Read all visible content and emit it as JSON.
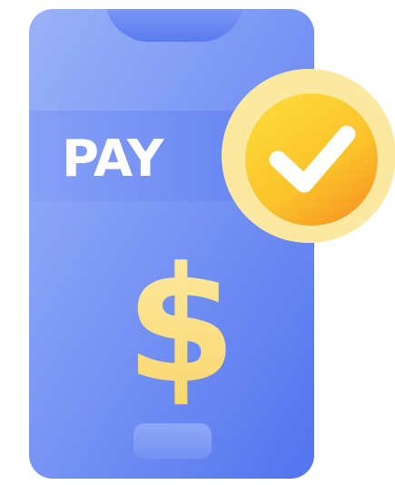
{
  "screen": {
    "pay_label": "PAY",
    "currency_symbol": "$"
  },
  "colors": {
    "phone_body_light": "#8fa9f7",
    "phone_body_dark": "#5c7df0",
    "phone_band_light": "#7c97f5",
    "phone_band_dark": "#5576ee",
    "notch": "#5e7ff0",
    "home_button": "#7d98f4",
    "pay_text": "#ffffff",
    "dollar_light": "#fde9a0",
    "dollar_dark": "#f9d66b",
    "badge_outer": "#fbe9a2",
    "badge_inner_light": "#fcd230",
    "badge_inner_dark": "#f7a625",
    "checkmark": "#ffffff"
  },
  "icons": {
    "phone": "smartphone-icon",
    "badge": "checkmark-badge-icon",
    "currency": "dollar-icon"
  }
}
